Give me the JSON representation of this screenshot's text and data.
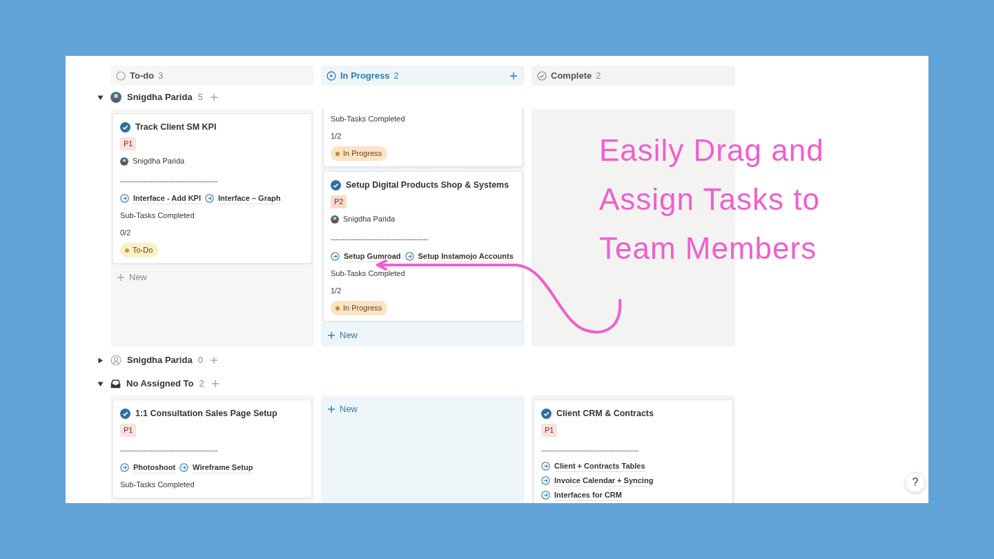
{
  "columns": [
    {
      "kind": "todo",
      "label": "To-do",
      "count": "3",
      "addable": false
    },
    {
      "kind": "progress",
      "label": "In Progress",
      "count": "2",
      "addable": true
    },
    {
      "kind": "complete",
      "label": "Complete",
      "count": "2",
      "addable": false
    }
  ],
  "groups": [
    {
      "kind": "member",
      "name": "Snigdha Parida",
      "count": "5",
      "expanded": true,
      "lanes": [
        {
          "cards": [
            {
              "title": "Track Client SM KPI",
              "priority": "P1",
              "assignee": "Snigdha Parida",
              "divider": "------------------------------------------",
              "links": [
                "Interface - Add KPI",
                "Interface – Graph"
              ],
              "links_stacked": false,
              "subtasks_label": "Sub-Tasks Completed",
              "subtasks": "0/2",
              "status": {
                "kind": "todo",
                "label": "To-Do"
              }
            }
          ],
          "new_label": "New"
        },
        {
          "cards": [
            {
              "partial": true,
              "subtasks_label": "Sub-Tasks Completed",
              "subtasks": "1/2",
              "status": {
                "kind": "progress",
                "label": "In Progress"
              }
            },
            {
              "partial": false,
              "title": "Setup Digital Products Shop & Systems",
              "priority": "P2",
              "assignee": "Snigdha Parida",
              "divider": "------------------------------------------",
              "links": [
                "Setup Gumroad",
                "Setup Instamojo Accounts"
              ],
              "links_stacked": false,
              "subtasks_label": "Sub-Tasks Completed",
              "subtasks": "1/2",
              "status": {
                "kind": "progress",
                "label": "In Progress"
              }
            }
          ],
          "new_label": "New",
          "new_first": false
        }
      ]
    },
    {
      "kind": "member_placeholder",
      "name": "Snigdha Parida",
      "count": "0",
      "expanded": false
    },
    {
      "kind": "unassigned",
      "name": "No Assigned To",
      "count": "2",
      "expanded": true,
      "lanes": [
        {
          "cards": [
            {
              "title": "1:1 Consultation Sales Page Setup",
              "priority": "P1",
              "divider": "------------------------------------------",
              "links": [
                "Photoshoot",
                "Wireframe Setup"
              ],
              "links_stacked": false,
              "subtasks_label": "Sub-Tasks Completed"
            }
          ]
        },
        {
          "new_label": "New",
          "new_first": true
        },
        {
          "cards": [
            {
              "title": "Client CRM & Contracts",
              "priority": "P1",
              "divider": "------------------------------------------",
              "links": [
                "Client + Contracts Tables",
                "Invoice Calendar + Syncing",
                "Interfaces for CRM"
              ],
              "links_stacked": true
            }
          ]
        }
      ]
    }
  ],
  "annotation": {
    "lines": [
      "Easily Drag and",
      "Assign Tasks to",
      "Team Members"
    ]
  },
  "help_button": "?"
}
